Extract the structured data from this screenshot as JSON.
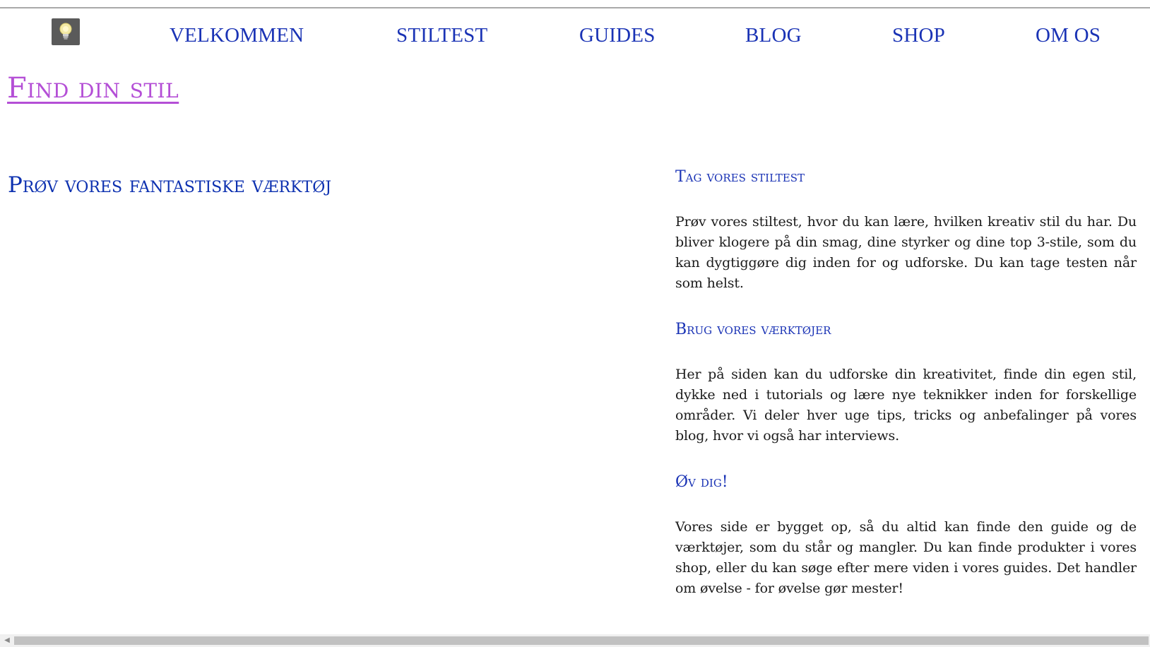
{
  "nav": {
    "logo_icon": "lightbulb-icon",
    "items": [
      {
        "label": "VELKOMMEN"
      },
      {
        "label": "STILTEST"
      },
      {
        "label": "GUIDES"
      },
      {
        "label": "BLOG"
      },
      {
        "label": "SHOP"
      },
      {
        "label": "OM OS"
      }
    ]
  },
  "site": {
    "title": "Find din stil"
  },
  "left": {
    "heading": "Prøv vores fantastiske værktøj"
  },
  "sections": [
    {
      "heading": "Tag vores stiltest",
      "text": "Prøv vores stiltest, hvor du kan lære, hvilken kreativ stil du har. Du bliver klogere på din smag, dine styrker og dine top 3-stile, som du kan dygtiggøre dig inden for og udforske. Du kan tage testen når som helst."
    },
    {
      "heading": "Brug vores værktøjer",
      "text": "Her på siden kan du udforske din kreativitet, finde din egen stil, dykke ned i tutorials og lære nye teknikker inden for forskellige områder. Vi deler hver uge tips, tricks og anbefalinger på vores blog, hvor vi også har interviews."
    },
    {
      "heading": "Øv dig!",
      "text": "Vores side er bygget op, så du altid kan finde den guide og de værktøjer, som du står og mangler. Du kan finde produkter i vores shop, eller du kan søge efter mere viden i vores guides. Det handler om øvelse - for øvelse gør mester!"
    }
  ],
  "colors": {
    "nav_link": "#1a33b5",
    "title": "#b44fd6",
    "heading": "#0d31b0",
    "body_text": "#1b1b1b"
  }
}
